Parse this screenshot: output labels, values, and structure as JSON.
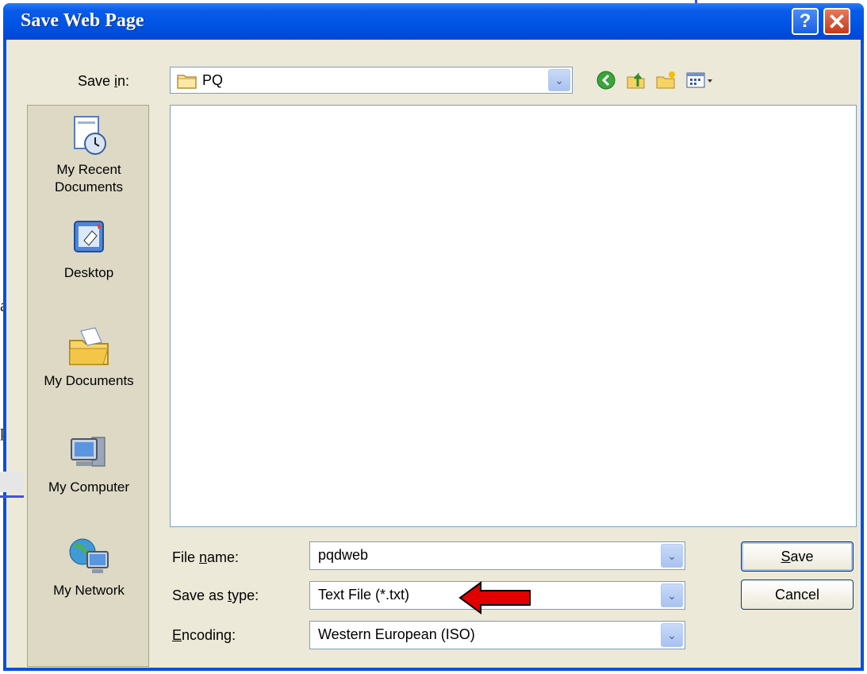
{
  "background": {
    "char_a": "a",
    "char_p": "p"
  },
  "dialog": {
    "title": "Save Web Page",
    "help_label": "?",
    "close_label": "✕",
    "save_in": {
      "label_pre": "Save ",
      "label_key": "i",
      "label_post": "n:",
      "value": "PQ"
    },
    "places": [
      {
        "line1": "My Recent",
        "line2": "Documents",
        "icon": "recent-documents-icon"
      },
      {
        "line1": "Desktop",
        "line2": "",
        "icon": "desktop-icon"
      },
      {
        "line1": "My Documents",
        "line2": "",
        "icon": "my-documents-icon"
      },
      {
        "line1": "My Computer",
        "line2": "",
        "icon": "my-computer-icon"
      },
      {
        "line1": "My Network",
        "line2": "",
        "icon": "my-network-icon"
      }
    ],
    "file_name": {
      "label_pre": "File ",
      "label_key": "n",
      "label_post": "ame:",
      "value": "pqdweb"
    },
    "save_as_type": {
      "label_pre": "Save as ",
      "label_key": "t",
      "label_post": "ype:",
      "value": "Text File (*.txt)"
    },
    "encoding": {
      "label_pre": "",
      "label_key": "E",
      "label_post": "ncoding:",
      "value": "Western European (ISO)"
    },
    "save_button": {
      "key": "S",
      "rest": "ave"
    },
    "cancel_button": "Cancel"
  },
  "colors": {
    "title_bar": "#0055e5",
    "client": "#ece9d8",
    "arrow": "#e00000"
  }
}
